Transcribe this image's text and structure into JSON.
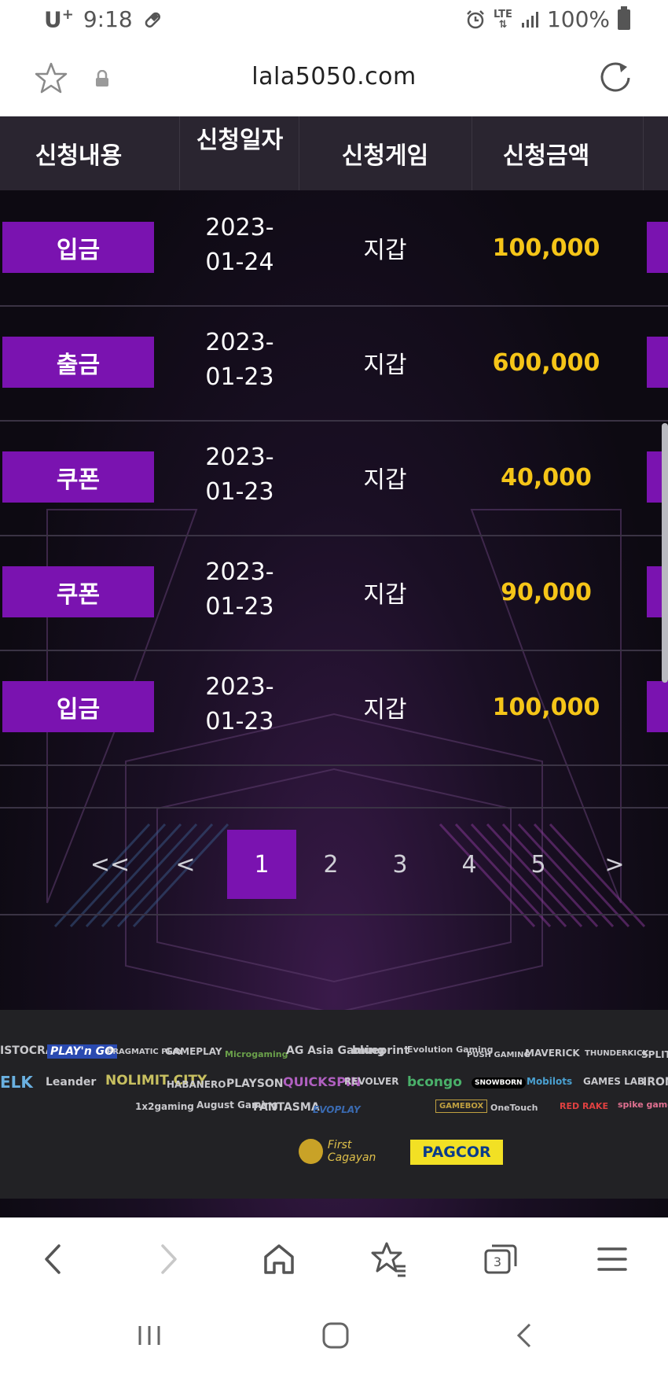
{
  "status_bar": {
    "carrier": "U",
    "carrier_sup": "+",
    "time": "9:18",
    "network": "LTE",
    "battery": "100%"
  },
  "browser": {
    "url": "lala5050.com"
  },
  "table": {
    "headers": [
      "신청내용",
      "신청일자",
      "신청게임",
      "신청금액"
    ],
    "rows": [
      {
        "type": "입금",
        "date_line1": "2023-",
        "date_line2": "01-24",
        "game": "지갑",
        "amount": "100,000"
      },
      {
        "type": "출금",
        "date_line1": "2023-",
        "date_line2": "01-23",
        "game": "지갑",
        "amount": "600,000"
      },
      {
        "type": "쿠폰",
        "date_line1": "2023-",
        "date_line2": "01-23",
        "game": "지갑",
        "amount": "40,000"
      },
      {
        "type": "쿠폰",
        "date_line1": "2023-",
        "date_line2": "01-23",
        "game": "지갑",
        "amount": "90,000"
      },
      {
        "type": "입금",
        "date_line1": "2023-",
        "date_line2": "01-23",
        "game": "지갑",
        "amount": "100,000"
      }
    ]
  },
  "pagination": {
    "first": "<<",
    "prev": "<",
    "pages": [
      "1",
      "2",
      "3",
      "4",
      "5"
    ],
    "current": "1",
    "next": ">"
  },
  "providers": {
    "row1": [
      "ISTOCRAT",
      "PLAY'n GO",
      "PRAGMATIC PLAY",
      "GAMEPLAY",
      "Microgaming",
      "AG Asia Gaming",
      "blueprint",
      "Evolution Gaming",
      "PUSH GAMING",
      "MAVERICK",
      "THUNDERKICK",
      "SPLIT"
    ],
    "row2": [
      "ELK",
      "Leander",
      "NOLIMIT CITY",
      "HABANERO",
      "PLAYSON",
      "QUICKSPIN",
      "REVOLVER",
      "bcongo",
      "SNOWBORN",
      "Mobilots",
      "GAMES LAB",
      "IRON"
    ],
    "row3": [
      "1x2gaming",
      "August Gaming",
      "FANTASMA",
      "EVOPLAY",
      "",
      "GAMEBOX",
      "OneTouch",
      "RED RAKE",
      "spike games"
    ],
    "first_cagayan": "First Cagayan",
    "pagcor": "PAGCOR"
  },
  "colors": {
    "accent": "#7a13b0",
    "amount": "#f5c518",
    "header_bg": "#2a2530",
    "footer_bg": "#222225"
  },
  "toolbar_icons": [
    "back-icon",
    "forward-icon",
    "home-icon",
    "bookmark-icon",
    "tabs-icon",
    "menu-icon"
  ],
  "tabs_count": "3"
}
